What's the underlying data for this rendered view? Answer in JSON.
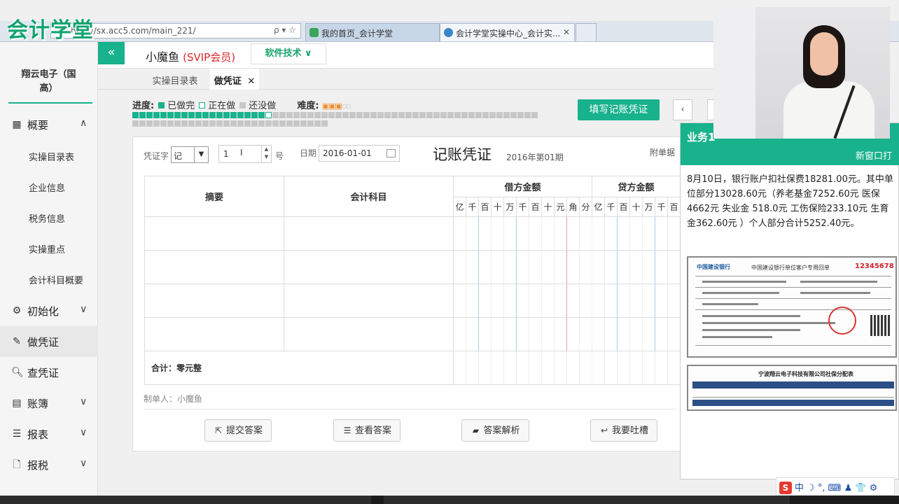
{
  "browser": {
    "url": "http://sx.acc5.com/main_221/",
    "addr_tools": "ρ ▾ ☆",
    "tabs": [
      {
        "label": "我的首页_会计学堂"
      },
      {
        "label": "会计学堂实操中心_会计实...",
        "close": "✕"
      }
    ]
  },
  "logo": {
    "text": "会计学堂"
  },
  "sidebar": {
    "company": "翔云电子（国高）",
    "collapse_icon": "«",
    "items": [
      {
        "label": "概要",
        "icon": "dashboard-icon",
        "chev": "∧"
      },
      {
        "label": "初始化",
        "icon": "gear-icon",
        "chev": "∨"
      },
      {
        "label": "做凭证",
        "icon": "pen-icon",
        "chev": ""
      },
      {
        "label": "查凭证",
        "icon": "search-icon",
        "chev": ""
      },
      {
        "label": "账簿",
        "icon": "book-icon",
        "chev": "∨"
      },
      {
        "label": "报表",
        "icon": "report-icon",
        "chev": "∨"
      },
      {
        "label": "报税",
        "icon": "file-icon",
        "chev": "∨"
      }
    ],
    "subitems": [
      "实操目录表",
      "企业信息",
      "税务信息",
      "实操重点",
      "会计科目概要"
    ]
  },
  "header": {
    "username": "小魔鱼",
    "vip": "(SVIP会员)",
    "software_button": "软件技术 ∨"
  },
  "subtabs": [
    {
      "label": "实操目录表"
    },
    {
      "label": "做凭证",
      "close": "✕"
    }
  ],
  "progress": {
    "label": "进度:",
    "done": "已做完",
    "doing": "正在做",
    "todo": "还没做",
    "difficulty_label": "难度:",
    "difficulty": 3,
    "difficulty_max": 5,
    "completed_count": 19,
    "current_index": 20,
    "total_count": 86,
    "colors": {
      "done": "#18b28c",
      "todo": "#c8c8c8"
    }
  },
  "actions": {
    "fill_voucher": "填写记账凭证",
    "prev": "‹"
  },
  "voucher": {
    "word_label": "凭证字",
    "word_value": "记",
    "number_value": "1",
    "number_suffix": "号",
    "date_label": "日期",
    "date_value": "2016-01-01",
    "title": "记账凭证",
    "period": "2016年第01期",
    "attach_label": "附单据",
    "columns": {
      "summary": "摘要",
      "account": "会计科目",
      "debit": "借方金额",
      "credit": "贷方金额"
    },
    "digits": [
      "亿",
      "千",
      "百",
      "十",
      "万",
      "千",
      "百",
      "十",
      "元",
      "角",
      "分"
    ],
    "credit_digits_visible": [
      "亿",
      "千",
      "百",
      "十",
      "万",
      "千",
      "百"
    ],
    "total_label": "合计：零元整",
    "maker_label": "制单人：小魔鱼",
    "buttons": [
      "提交答案",
      "查看答案",
      "答案解析",
      "我要吐槽"
    ]
  },
  "task_panel": {
    "title": "业务1",
    "new_window": "新窗口打",
    "description": "8月10日，银行账户扣社保费18281.00元。其中单位部分13028.60元（养老基金7252.60元 医保4662元 失业金 518.0元 工伤保险233.10元 生育金362.60元 ）个人部分合计5252.40元。",
    "receipt1": {
      "bank": "中国建设银行",
      "title": "中国建设银行单位客户专用回单",
      "no": "12345678"
    },
    "receipt2": {
      "title": "宁波翔云电子科技有限公司社保分配表"
    }
  },
  "ime": {
    "text": "中 ☽ °, ⌨ ♟ 👕 ⚙"
  }
}
